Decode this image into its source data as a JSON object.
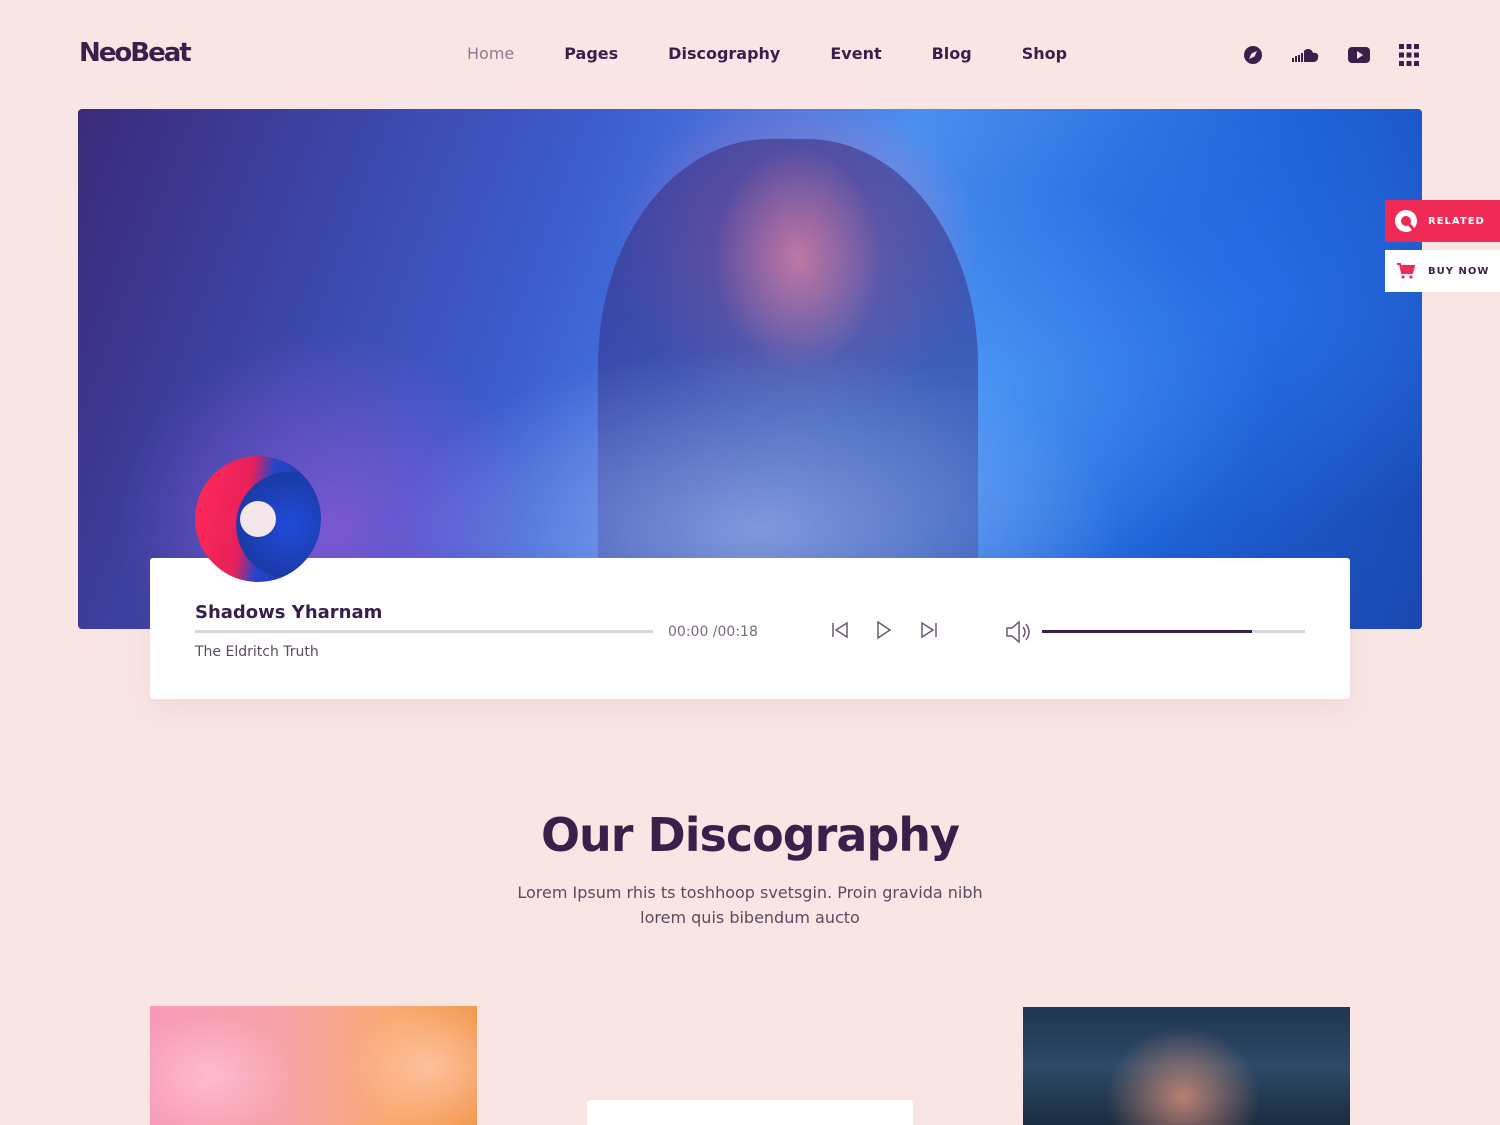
{
  "brand": {
    "logo": "NeoBeat"
  },
  "nav": {
    "items": [
      {
        "label": "Home",
        "active": true
      },
      {
        "label": "Pages",
        "active": false
      },
      {
        "label": "Discography",
        "active": false
      },
      {
        "label": "Event",
        "active": false
      },
      {
        "label": "Blog",
        "active": false
      },
      {
        "label": "Shop",
        "active": false
      }
    ]
  },
  "social_icons": [
    "compass-icon",
    "soundcloud-icon",
    "youtube-icon",
    "grid-menu-icon"
  ],
  "side_tabs": {
    "related": {
      "label": "RELATED",
      "icon": "related-icon",
      "color": "#ef2a55"
    },
    "buy": {
      "label": "BUY NOW",
      "icon": "cart-icon"
    }
  },
  "player": {
    "title": "Shadows Yharnam",
    "artist": "The Eldritch Truth",
    "time": "00:00 /00:18",
    "progress": 0,
    "volume": 0.8,
    "controls": [
      "previous-icon",
      "play-icon",
      "next-icon"
    ]
  },
  "discography": {
    "title": "Our Discography",
    "subtitle": "Lorem Ipsum rhis ts toshhoop svetsgin. Proin gravida nibh lorem quis bibendum aucto"
  },
  "colors": {
    "background": "#f9e6e4",
    "primary_text": "#3a1f4a",
    "accent": "#ef2a55"
  }
}
